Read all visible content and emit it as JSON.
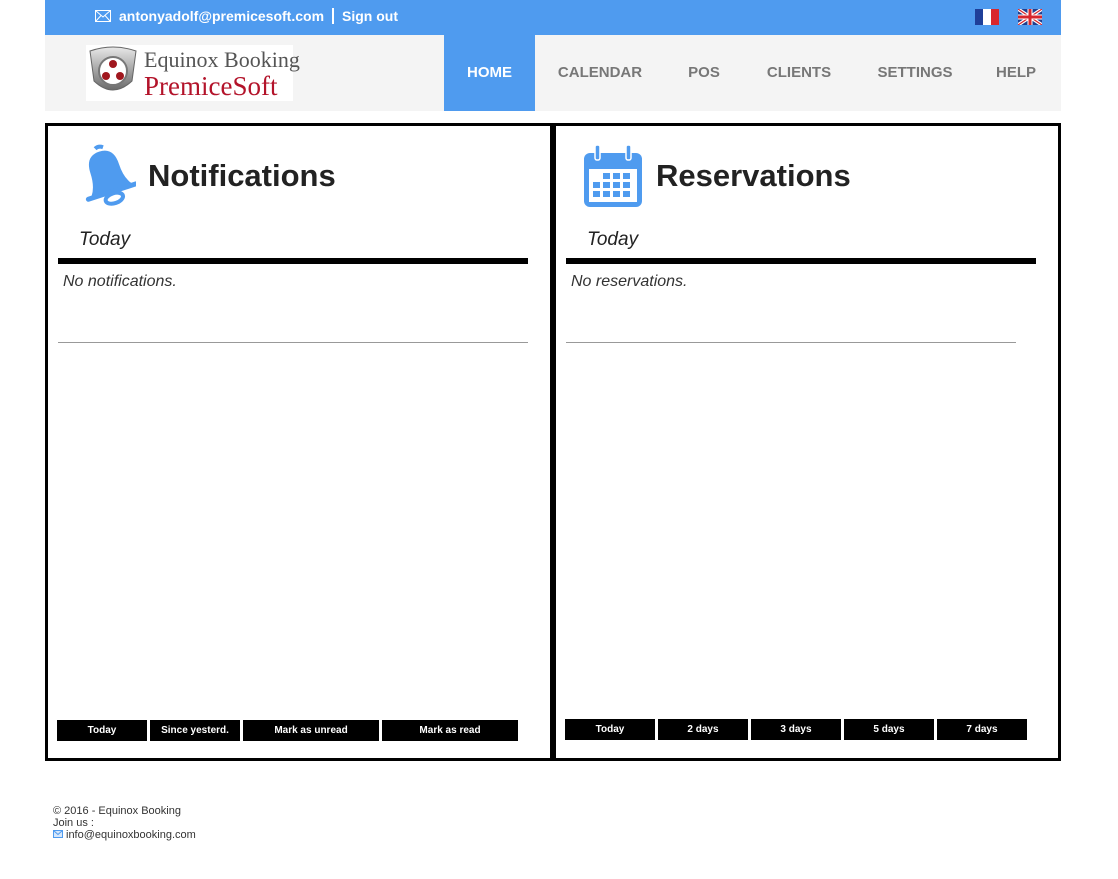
{
  "topbar": {
    "email": "antonyadolf@premicesoft.com",
    "signout": "Sign out",
    "languages": [
      "french-flag",
      "english-flag"
    ]
  },
  "logo": {
    "line1": "Equinox Booking",
    "line2": "PremiceSoft"
  },
  "nav": {
    "items": [
      {
        "label": "HOME",
        "active": true
      },
      {
        "label": "CALENDAR"
      },
      {
        "label": "POS"
      },
      {
        "label": "CLIENTS"
      },
      {
        "label": "SETTINGS"
      },
      {
        "label": "HELP"
      }
    ]
  },
  "notifications": {
    "title": "Notifications",
    "period": "Today",
    "empty": "No notifications.",
    "buttons": [
      "Today",
      "Since yesterd.",
      "Mark as unread",
      "Mark as read"
    ]
  },
  "reservations": {
    "title": "Reservations",
    "period": "Today",
    "empty": "No reservations.",
    "buttons": [
      "Today",
      "2 days",
      "3 days",
      "5 days",
      "7 days"
    ]
  },
  "footer": {
    "copyright": "© 2016 - Equinox Booking",
    "join": "Join us :",
    "email": "info@equinoxbooking.com"
  },
  "colors": {
    "accent": "#4f9bef",
    "logo_red": "#b3132a"
  }
}
